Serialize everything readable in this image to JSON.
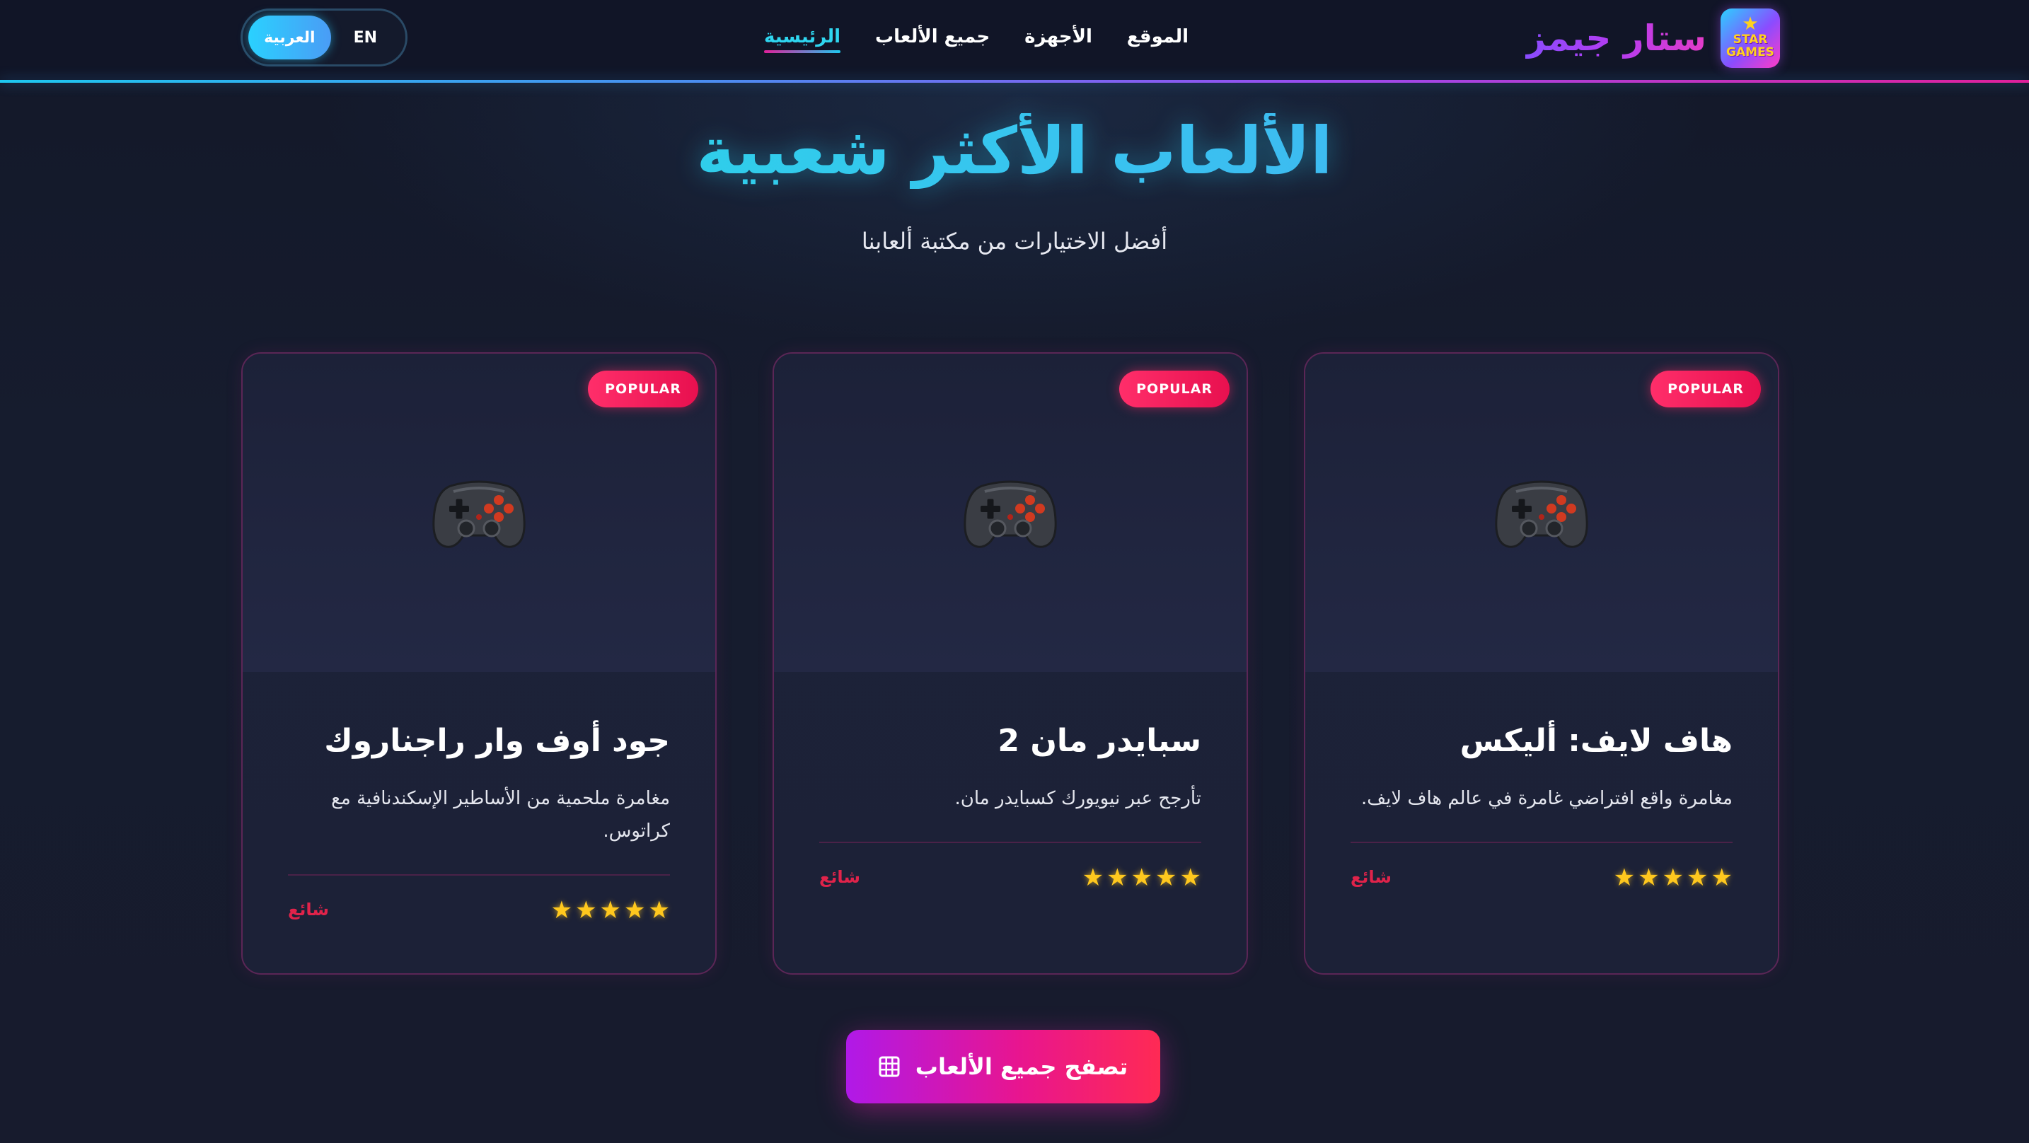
{
  "header": {
    "brand_name": "ستار جيمز",
    "logo_text_line1": "STAR",
    "logo_text_line2": "GAMES",
    "nav": [
      {
        "label": "الرئيسية",
        "active": true
      },
      {
        "label": "جميع الألعاب",
        "active": false
      },
      {
        "label": "الأجهزة",
        "active": false
      },
      {
        "label": "الموقع",
        "active": false
      }
    ],
    "lang": {
      "arabic": "العربية",
      "english": "EN",
      "selected": "العربية"
    }
  },
  "hero": {
    "title": "الألعاب الأكثر شعبية",
    "subtitle": "أفضل الاختيارات من مكتبة ألعابنا"
  },
  "cards": [
    {
      "badge": "POPULAR",
      "icon": "gamepad-icon",
      "title": "هاف لايف: أليكس",
      "description": "مغامرة واقع افتراضي غامرة في عالم هاف لايف.",
      "rating": 5,
      "rating_stars": "⭐⭐⭐⭐⭐",
      "status": "شائع"
    },
    {
      "badge": "POPULAR",
      "icon": "gamepad-icon",
      "title": "سبايدر مان 2",
      "description": "تأرجح عبر نيويورك كسبايدر مان.",
      "rating": 5,
      "rating_stars": "⭐⭐⭐⭐⭐",
      "status": "شائع"
    },
    {
      "badge": "POPULAR",
      "icon": "gamepad-icon",
      "title": "جود أوف وار راجناروك",
      "description": "مغامرة ملحمية من الأساطير الإسكندنافية مع كراتوس.",
      "rating": 5,
      "rating_stars": "⭐⭐⭐⭐⭐",
      "status": "شائع"
    }
  ],
  "cta": {
    "label": "تصفح جميع الألعاب",
    "icon": "grid-icon"
  },
  "colors": {
    "background": "#151a2b",
    "accent_cyan": "#2fd6f0",
    "accent_pink": "#e8158f",
    "badge_red": "#ff2e6a",
    "star_gold": "#ffc81e",
    "status_red": "#e0234a"
  }
}
